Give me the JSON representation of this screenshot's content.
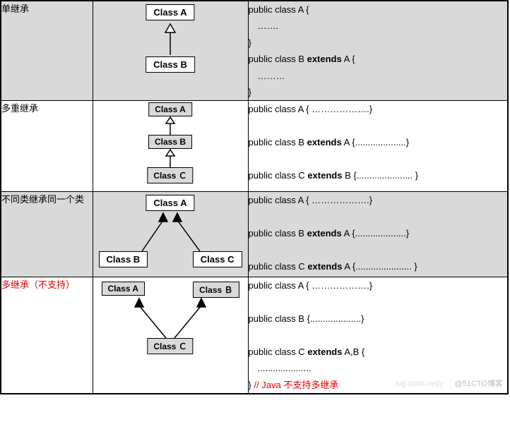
{
  "rows": [
    {
      "label": "单继承",
      "boxes": {
        "a": "Class A",
        "b": "Class B"
      },
      "code": [
        "public class A {",
        "　…….",
        "}",
        "public class B <b>extends</b> A {",
        "　………",
        "}"
      ]
    },
    {
      "label": "多重继承",
      "boxes": {
        "a": "Class A",
        "b": "Class B",
        "c": "Class Ｃ"
      },
      "code": [
        "public class A { ……………….}",
        "",
        "public class B <b>extends</b> A {....................}",
        "",
        "public class C <b>extends</b>  B {...................... }"
      ]
    },
    {
      "label": "不同类继承同一个类",
      "boxes": {
        "a": "Class A",
        "b": "Class B",
        "c": "Class C"
      },
      "code": [
        "public class A { ……………….}",
        "",
        "public class B <b>extends</b> A {....................}",
        "",
        "public class C <b>extends</b> A {...................... }"
      ]
    },
    {
      "label": "多继承（不支持）",
      "boxes": {
        "a": "Class A",
        "b": "Class Ｂ",
        "c": "Class Ｃ"
      },
      "code": [
        "public class A { ……………….}",
        "",
        "public class B {....................}",
        "",
        "public class C <b>extends</b>  A,B {",
        "　.....................",
        "} <span class=red>// Java  不支持多继承</span>"
      ]
    }
  ],
  "watermark": "@51CTO博客",
  "watermark2": "log.csdn.net/y"
}
